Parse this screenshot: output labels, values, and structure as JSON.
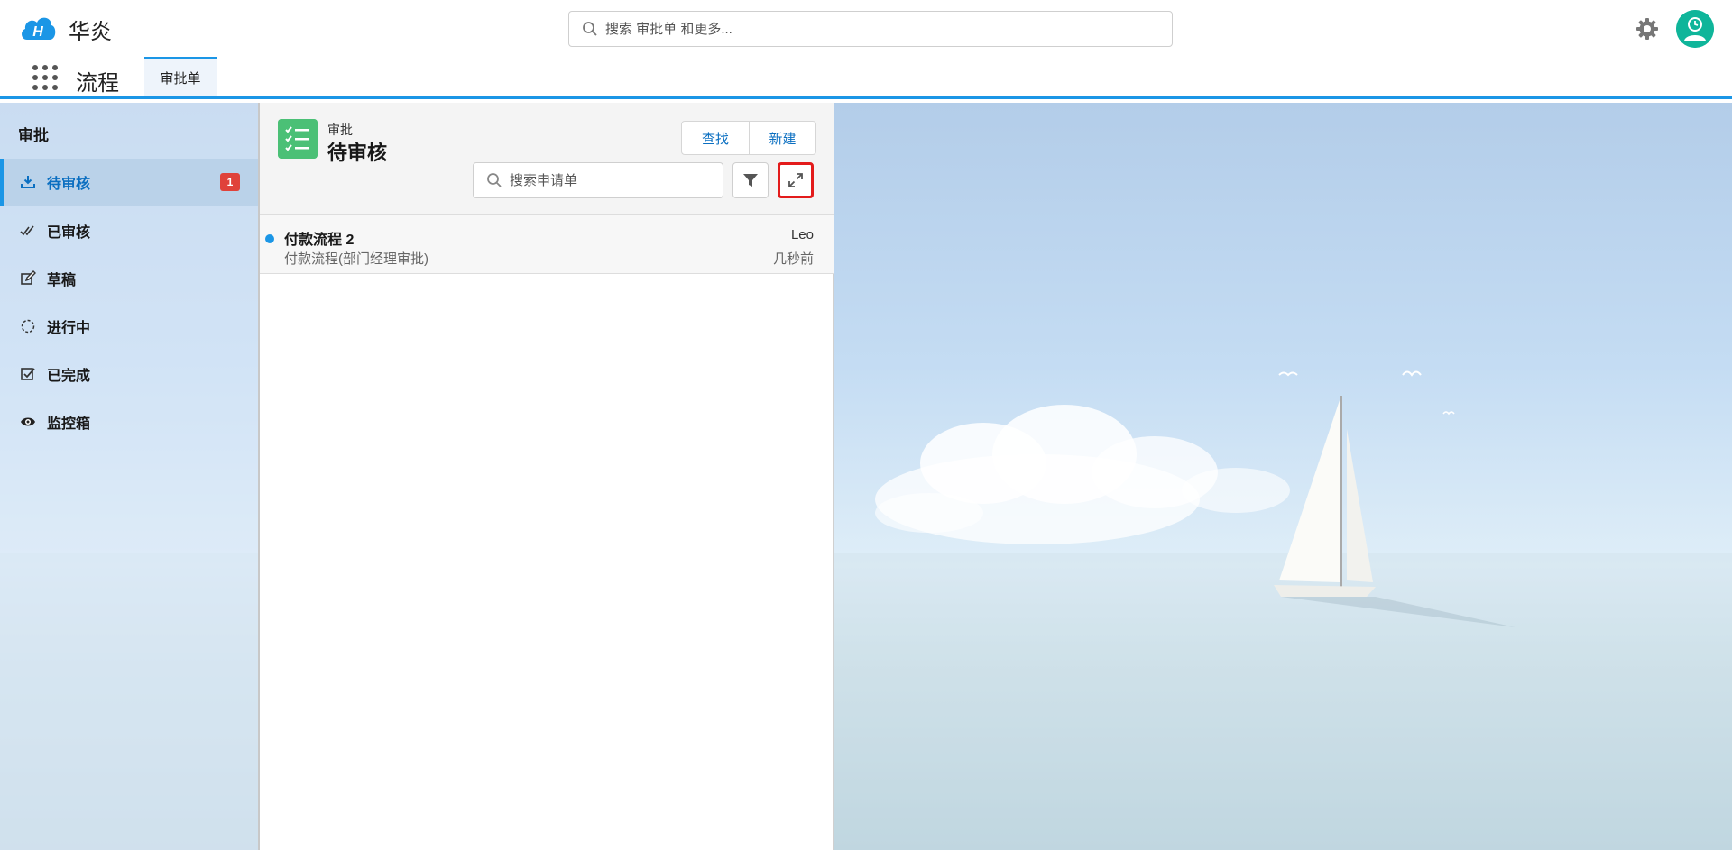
{
  "header": {
    "brand": "华炎",
    "search_placeholder": "搜索 审批单 和更多...",
    "app_name": "流程",
    "tab_label": "审批单"
  },
  "sidebar": {
    "title": "审批",
    "items": [
      {
        "label": "待审核",
        "icon": "inbox-download-icon",
        "badge": "1",
        "active": true
      },
      {
        "label": "已审核",
        "icon": "double-check-icon"
      },
      {
        "label": "草稿",
        "icon": "edit-icon"
      },
      {
        "label": "进行中",
        "icon": "spinner-icon"
      },
      {
        "label": "已完成",
        "icon": "checkbox-icon"
      },
      {
        "label": "监控箱",
        "icon": "eye-icon"
      }
    ]
  },
  "list": {
    "object_subtitle": "审批",
    "object_title": "待审核",
    "find_label": "查找",
    "new_label": "新建",
    "search_placeholder": "搜索申请单",
    "records": [
      {
        "title": "付款流程 2",
        "subtitle": "付款流程(部门经理审批)",
        "owner": "Leo",
        "time": "几秒前"
      }
    ]
  },
  "colors": {
    "accent": "#1b96e6",
    "badge": "#e0423a",
    "object_icon": "#4bc076",
    "avatar": "#0fb59a",
    "highlight_border": "#e31b1b"
  }
}
